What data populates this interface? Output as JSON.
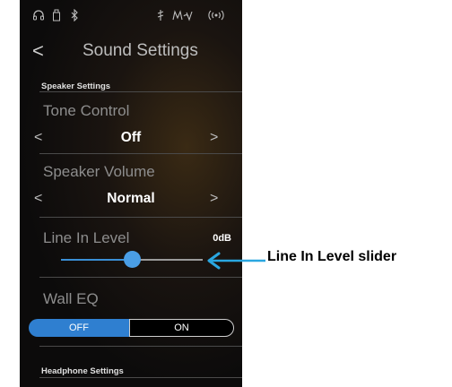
{
  "statusbar": {
    "icons": [
      "headphones-icon",
      "usb-icon",
      "bluetooth-icon",
      "metronome-icon",
      "registration-icon",
      "wireless-icon"
    ],
    "glyphs": {
      "headphones": "🎧",
      "usb": "⌷",
      "bluetooth": "ᛒ",
      "metronome": "♯",
      "registration": "Mch",
      "wireless": "((•))"
    }
  },
  "header": {
    "back_glyph": "<",
    "title": "Sound Settings"
  },
  "sections": {
    "speaker_label": "Speaker Settings",
    "headphone_label": "Headphone Settings"
  },
  "tone_control": {
    "title": "Tone Control",
    "value": "Off",
    "prev": "<",
    "next": ">"
  },
  "speaker_volume": {
    "title": "Speaker Volume",
    "value": "Normal",
    "prev": "<",
    "next": ">"
  },
  "line_in_level": {
    "title": "Line In Level",
    "value": "0dB",
    "slider_fraction": 0.5
  },
  "wall_eq": {
    "title": "Wall EQ",
    "off_label": "OFF",
    "on_label": "ON",
    "selected": "OFF"
  },
  "annotation": {
    "label": "Line In Level slider"
  },
  "colors": {
    "accent": "#3a8fd6",
    "background": "#0c0b0b",
    "annotation_arrow": "#2aa7e0"
  }
}
